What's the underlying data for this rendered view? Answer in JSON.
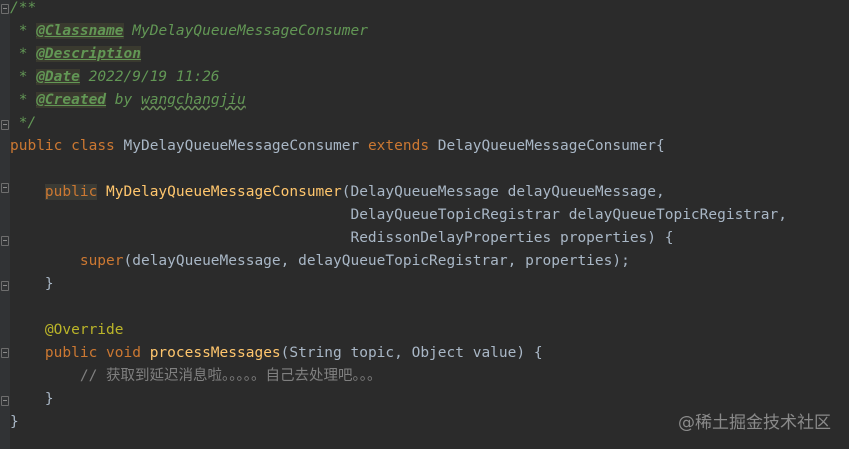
{
  "comment": {
    "open": "/**",
    "prefix": " * ",
    "close": " */",
    "classname_tag": "@Classname",
    "classname_value": "MyDelayQueueMessageConsumer",
    "description_tag": "@Description",
    "date_tag": "@Date",
    "date_value": "2022/9/19 11:26",
    "created_tag": "@Created",
    "created_by": "by",
    "created_value": "wangchangjiu"
  },
  "class_decl": {
    "public": "public",
    "class": "class",
    "name": "MyDelayQueueMessageConsumer",
    "extends": "extends",
    "parent": "DelayQueueMessageConsumer{"
  },
  "ctor": {
    "public": "public",
    "name": "MyDelayQueueMessageConsumer",
    "params1": "(DelayQueueMessage delayQueueMessage,",
    "params2": "DelayQueueTopicRegistrar delayQueueTopicRegistrar,",
    "params3": "RedissonDelayProperties properties) {",
    "super_kw": "super",
    "super_args": "(delayQueueMessage, delayQueueTopicRegistrar, properties);",
    "close": "}"
  },
  "method": {
    "annotation": "@Override",
    "public": "public",
    "void": "void",
    "name": "processMessages",
    "params": "(String topic, Object value) {",
    "comment": "// 获取到延迟消息啦。。。。。自己去处理吧。。。",
    "close": "}"
  },
  "class_close": "}",
  "watermark": "@稀土掘金技术社区"
}
